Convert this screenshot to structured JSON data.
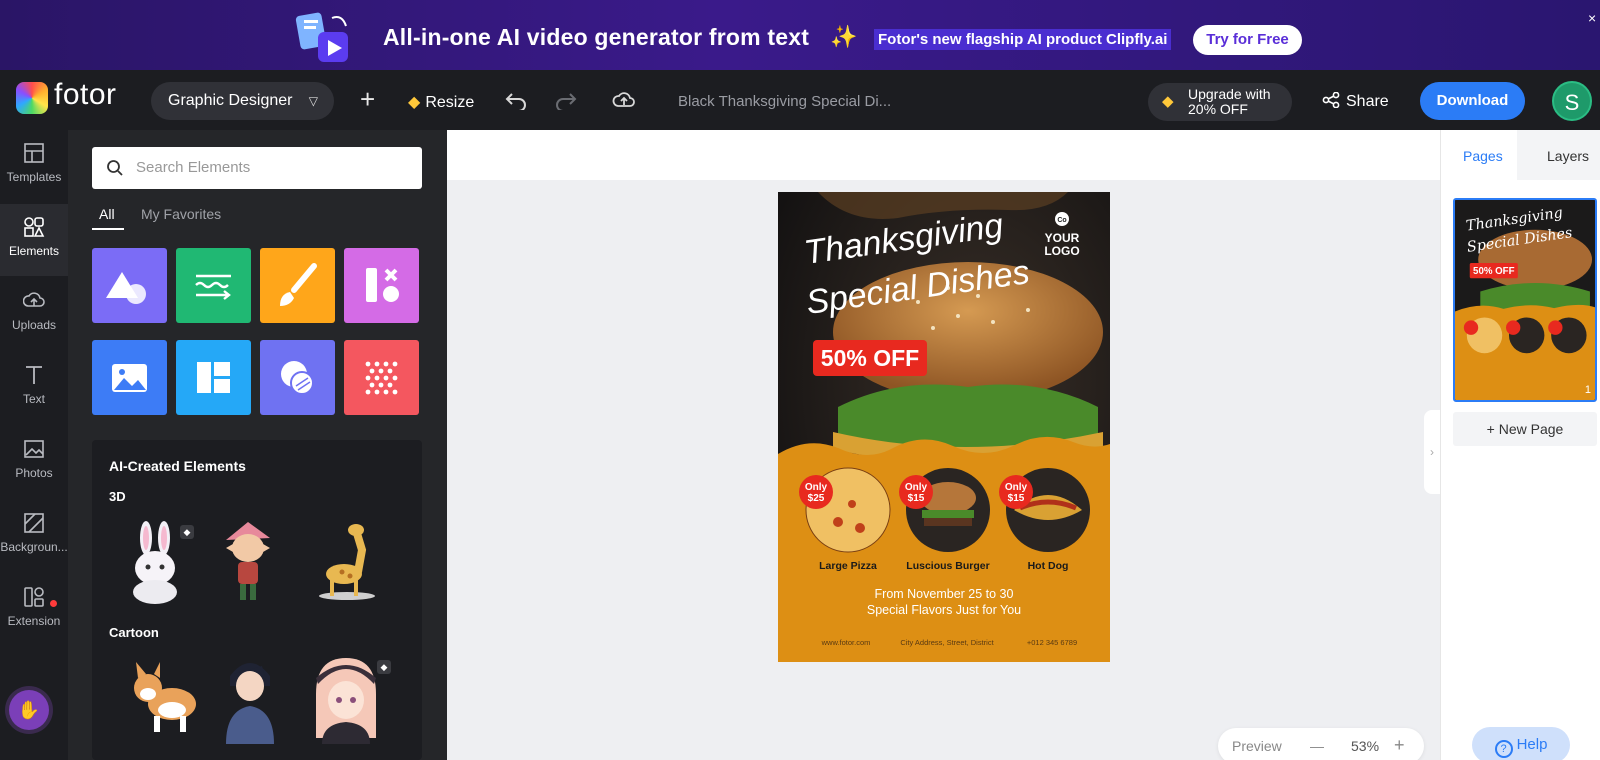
{
  "banner": {
    "headline": "All-in-one AI video generator from text",
    "sub": "Fotor's new flagship AI product Clipfly.ai",
    "cta": "Try for Free",
    "close": "×"
  },
  "toolbar": {
    "logo": "fotor",
    "role": "Graphic Designer",
    "resize": "Resize",
    "doc_name": "Black Thanksgiving Special Di...",
    "upgrade_line1": "Upgrade with",
    "upgrade_line2": "20% OFF",
    "share": "Share",
    "download": "Download",
    "avatar_initial": "S"
  },
  "rail": {
    "items": [
      "Templates",
      "Elements",
      "Uploads",
      "Text",
      "Photos",
      "Backgroun...",
      "Extension"
    ]
  },
  "panel": {
    "search_placeholder": "Search Elements",
    "tabs": [
      "All",
      "My Favorites"
    ],
    "tiles": [
      {
        "name": "shapes",
        "color": "#7b6cf6"
      },
      {
        "name": "lines",
        "color": "#20b873"
      },
      {
        "name": "illustrations",
        "color": "#ffa61a"
      },
      {
        "name": "icons",
        "color": "#d46be6"
      },
      {
        "name": "photos",
        "color": "#3d7cf6"
      },
      {
        "name": "frames",
        "color": "#25a8f7"
      },
      {
        "name": "stickers",
        "color": "#6f72f2"
      },
      {
        "name": "patterns",
        "color": "#f4575f"
      }
    ],
    "ai_title": "AI-Created Elements",
    "ai_sections": [
      "3D",
      "Cartoon"
    ]
  },
  "poster": {
    "title_line1": "Thanksgiving",
    "title_line2": "Special Dishes",
    "logo_line1": "YOUR",
    "logo_line2": "LOGO",
    "logo_badge": "Co",
    "discount": "50% OFF",
    "items": [
      {
        "label": "Large Pizza",
        "price_top": "Only",
        "price": "$25"
      },
      {
        "label": "Luscious Burger",
        "price_top": "Only",
        "price": "$15"
      },
      {
        "label": "Hot Dog",
        "price_top": "Only",
        "price": "$15"
      }
    ],
    "date_line": "From November 25 to 30",
    "tag_line": "Special Flavors Just for You",
    "footer": [
      "www.fotor.com",
      "City Address, Street, District",
      "+012 345 6789"
    ]
  },
  "zoom": {
    "preview": "Preview",
    "minus": "—",
    "value": "53%",
    "plus": "+"
  },
  "pages": {
    "tabs": [
      "Pages",
      "Layers"
    ],
    "page_number": "1",
    "new_page": "+ New Page",
    "help": "Help"
  },
  "colors": {
    "accent": "#2b7cf6",
    "poster_orange": "#dd8f14",
    "badge_red": "#e8291f"
  }
}
